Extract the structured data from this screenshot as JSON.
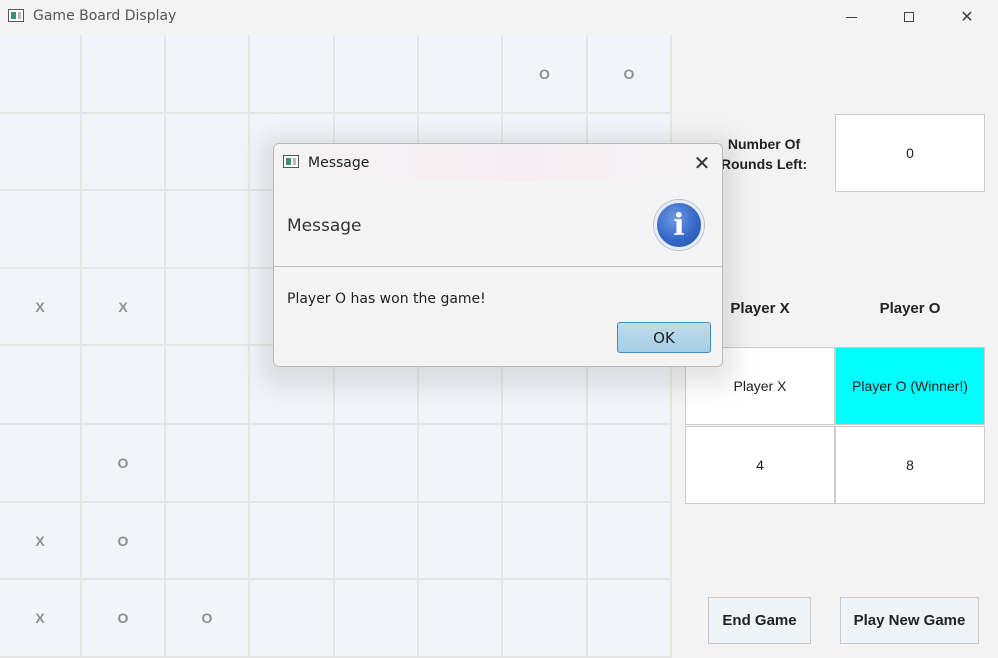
{
  "window": {
    "title": "Game Board Display"
  },
  "board": {
    "cells": [
      [
        "",
        "",
        "",
        "",
        "",
        "",
        "O",
        "O"
      ],
      [
        "",
        "",
        "",
        "",
        "",
        "",
        "",
        ""
      ],
      [
        "",
        "",
        "",
        "",
        "",
        "",
        "",
        ""
      ],
      [
        "X",
        "X",
        "",
        "",
        "",
        "",
        "",
        ""
      ],
      [
        "",
        "",
        "",
        "",
        "",
        "",
        "",
        ""
      ],
      [
        "",
        "O",
        "",
        "",
        "",
        "",
        "",
        ""
      ],
      [
        "X",
        "O",
        "",
        "",
        "",
        "",
        "",
        ""
      ],
      [
        "X",
        "O",
        "O",
        "",
        "",
        "",
        "",
        ""
      ]
    ]
  },
  "rounds": {
    "label_line1": "Number Of",
    "label_line2": "Rounds Left:",
    "value": "0"
  },
  "players": {
    "x_header": "Player X",
    "o_header": "Player O",
    "x_name": "Player X",
    "o_name": "Player O (Winner!)",
    "x_score": "4",
    "o_score": "8",
    "winner_color": "#00ffff"
  },
  "actions": {
    "end_game": "End Game",
    "new_game": "Play New Game"
  },
  "dialog": {
    "title": "Message",
    "header": "Message",
    "icon": "i",
    "message": "Player O has won the game!",
    "ok_label": "OK"
  }
}
